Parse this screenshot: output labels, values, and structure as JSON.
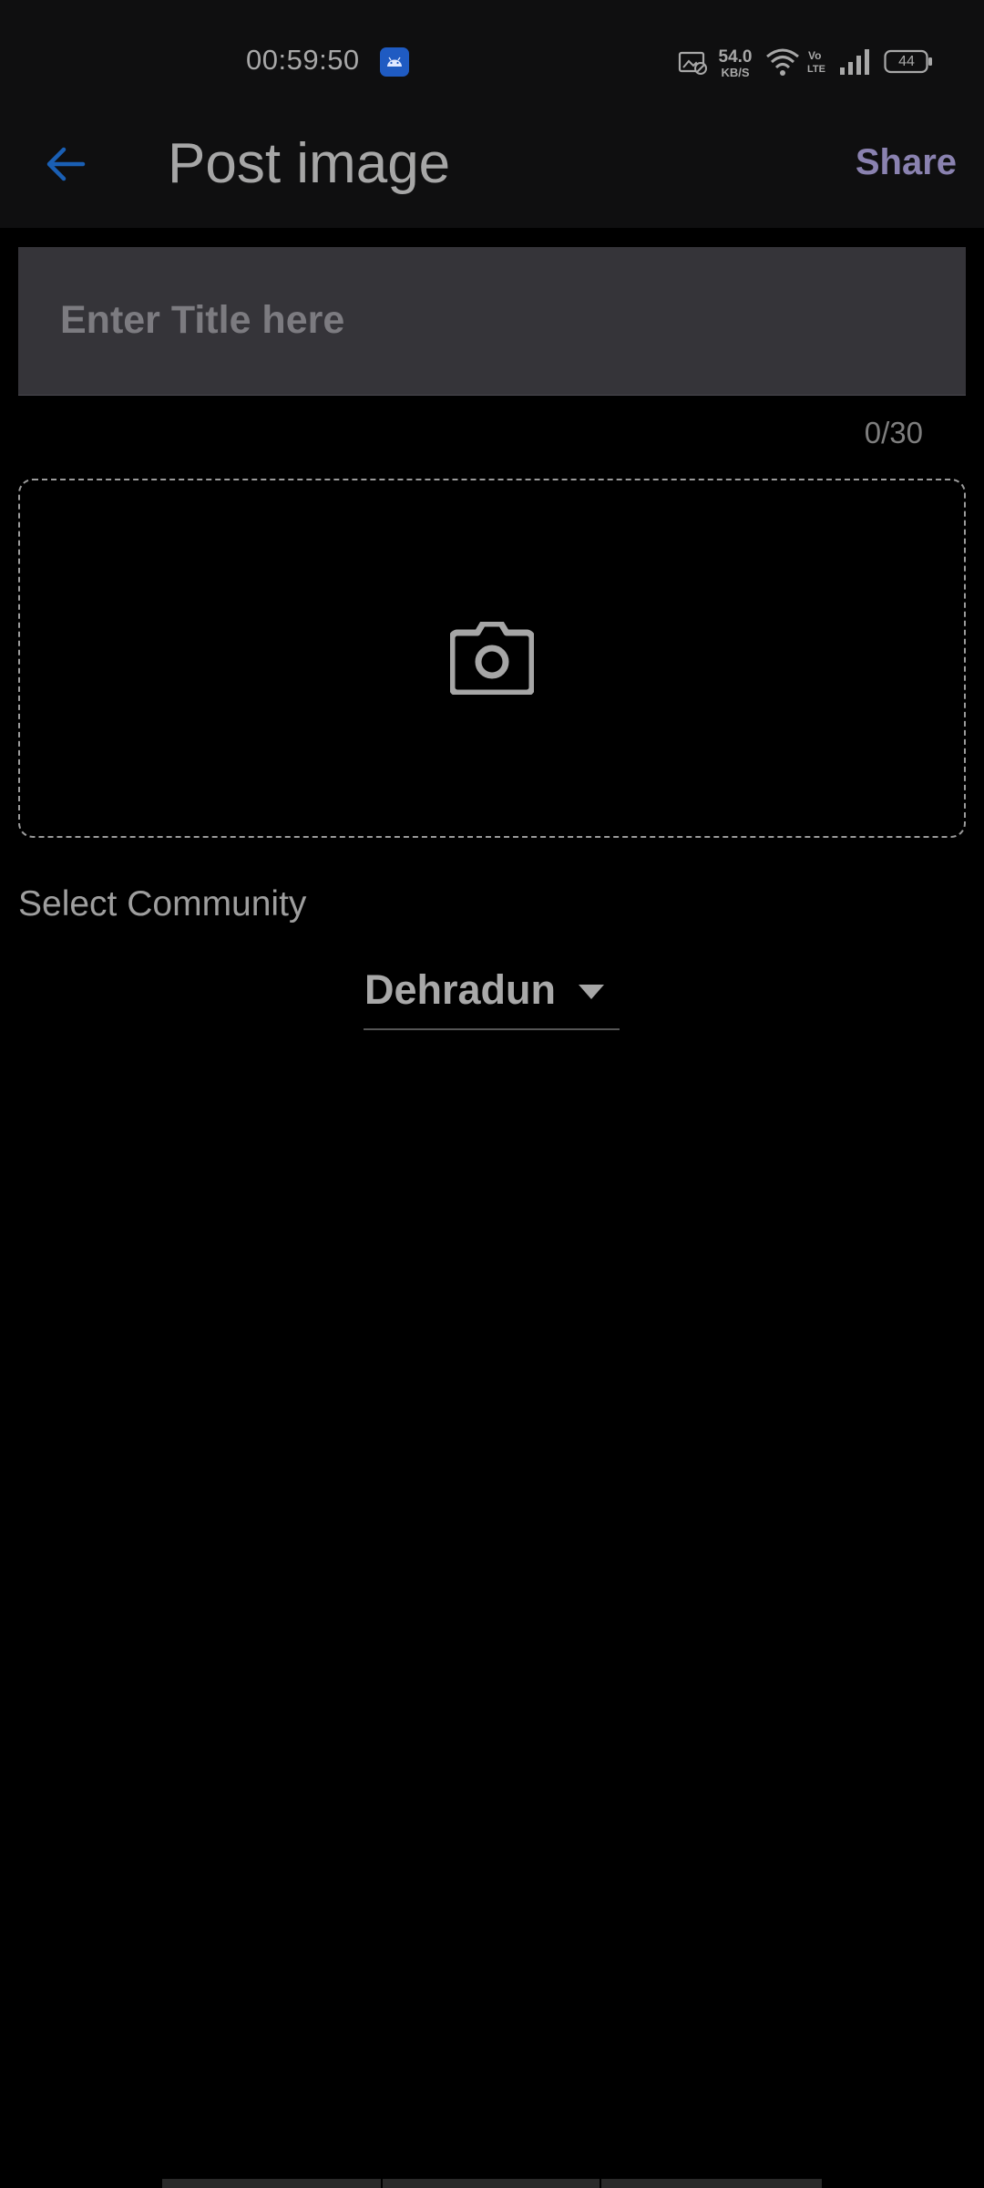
{
  "status_bar": {
    "time": "00:59:50",
    "net_speed_value": "54.0",
    "net_speed_unit": "KB/S",
    "battery_level": "44",
    "app_icon": "android-icon",
    "icons": [
      "screen-record-icon",
      "wifi-icon",
      "volte-icon",
      "signal-icon",
      "battery-icon"
    ]
  },
  "app_bar": {
    "title": "Post image",
    "share_label": "Share",
    "back_icon": "arrow-left-icon"
  },
  "title_field": {
    "placeholder": "Enter Title here",
    "value": "",
    "counter": "0/30"
  },
  "image_picker": {
    "icon": "camera-icon"
  },
  "community": {
    "label": "Select Community",
    "selected": "Dehradun",
    "caret_icon": "caret-down-icon"
  },
  "colors": {
    "background": "#000000",
    "app_bar": "#0f0f10",
    "accent_back": "#1a5fb4",
    "share": "#8a82b0",
    "field_bg": "#353439"
  }
}
